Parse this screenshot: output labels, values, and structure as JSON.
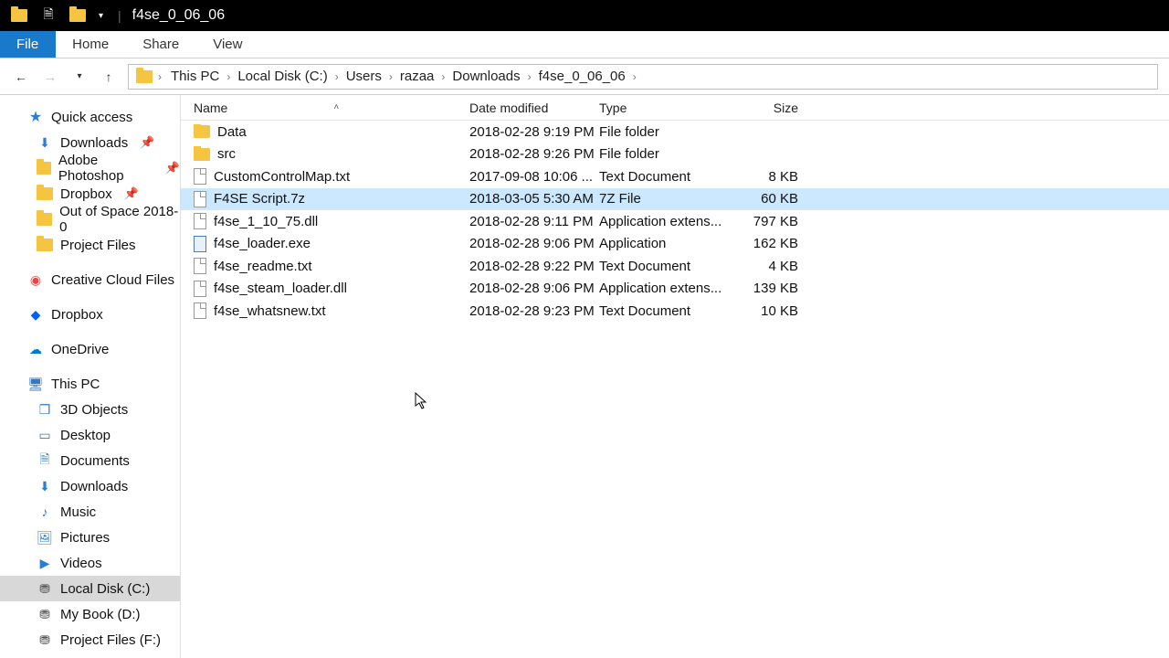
{
  "titlebar": {
    "title": "f4se_0_06_06"
  },
  "tabs": {
    "file": "File",
    "home": "Home",
    "share": "Share",
    "view": "View"
  },
  "breadcrumbs": [
    "This PC",
    "Local Disk (C:)",
    "Users",
    "razaa",
    "Downloads",
    "f4se_0_06_06"
  ],
  "columns": {
    "name": "Name",
    "date": "Date modified",
    "type": "Type",
    "size": "Size"
  },
  "sidebar": {
    "quick_access": "Quick access",
    "quick_items": [
      {
        "label": "Downloads",
        "icon": "down",
        "pinned": true
      },
      {
        "label": "Adobe Photoshop",
        "icon": "folder",
        "pinned": true
      },
      {
        "label": "Dropbox",
        "icon": "folder",
        "pinned": true
      },
      {
        "label": "Out of Space 2018-0",
        "icon": "folder",
        "pinned": false
      },
      {
        "label": "Project Files",
        "icon": "folder",
        "pinned": false
      }
    ],
    "creative_cloud": "Creative Cloud Files",
    "dropbox": "Dropbox",
    "onedrive": "OneDrive",
    "thispc": "This PC",
    "thispc_items": [
      {
        "label": "3D Objects",
        "icon": "obj3d"
      },
      {
        "label": "Desktop",
        "icon": "desktop"
      },
      {
        "label": "Documents",
        "icon": "docs"
      },
      {
        "label": "Downloads",
        "icon": "down"
      },
      {
        "label": "Music",
        "icon": "music"
      },
      {
        "label": "Pictures",
        "icon": "pic"
      },
      {
        "label": "Videos",
        "icon": "vid"
      },
      {
        "label": "Local Disk (C:)",
        "icon": "disk",
        "selected": true
      },
      {
        "label": "My Book (D:)",
        "icon": "disk"
      },
      {
        "label": "Project Files (F:)",
        "icon": "disk"
      }
    ]
  },
  "files": [
    {
      "name": "Data",
      "date": "2018-02-28 9:19 PM",
      "type": "File folder",
      "size": "",
      "icon": "folder"
    },
    {
      "name": "src",
      "date": "2018-02-28 9:26 PM",
      "type": "File folder",
      "size": "",
      "icon": "folder"
    },
    {
      "name": "CustomControlMap.txt",
      "date": "2017-09-08 10:06 ...",
      "type": "Text Document",
      "size": "8 KB",
      "icon": "file"
    },
    {
      "name": "F4SE Script.7z",
      "date": "2018-03-05 5:30 AM",
      "type": "7Z File",
      "size": "60 KB",
      "icon": "file",
      "selected": true
    },
    {
      "name": "f4se_1_10_75.dll",
      "date": "2018-02-28 9:11 PM",
      "type": "Application extens...",
      "size": "797 KB",
      "icon": "file"
    },
    {
      "name": "f4se_loader.exe",
      "date": "2018-02-28 9:06 PM",
      "type": "Application",
      "size": "162 KB",
      "icon": "exe"
    },
    {
      "name": "f4se_readme.txt",
      "date": "2018-02-28 9:22 PM",
      "type": "Text Document",
      "size": "4 KB",
      "icon": "file"
    },
    {
      "name": "f4se_steam_loader.dll",
      "date": "2018-02-28 9:06 PM",
      "type": "Application extens...",
      "size": "139 KB",
      "icon": "file"
    },
    {
      "name": "f4se_whatsnew.txt",
      "date": "2018-02-28 9:23 PM",
      "type": "Text Document",
      "size": "10 KB",
      "icon": "file"
    }
  ]
}
